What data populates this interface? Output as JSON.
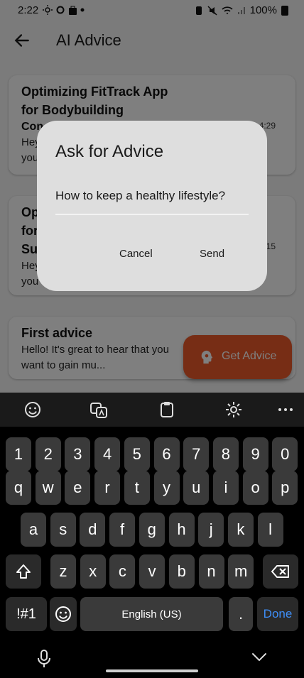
{
  "status": {
    "time": "2:22",
    "battery": "100%"
  },
  "appbar": {
    "title": "AI Advice"
  },
  "cards": [
    {
      "title_line1": "Optimizing FitTrack App",
      "title_line2": "for Bodybuilding",
      "title_line3": "Con",
      "time": "4:29",
      "body_line1": "Hey",
      "body_line2": "you"
    },
    {
      "title_line1": "Op",
      "title_line2": "for",
      "title_line3": "Su",
      "time": "15",
      "body_line1": "Hey",
      "body_line2": "you"
    },
    {
      "title_line1": "First advice",
      "body_line1": "Hello! It's great to hear that you",
      "body_line2": "want to gain mu..."
    }
  ],
  "fab": {
    "label": "Get Advice",
    "icon": "head-gear-icon"
  },
  "dialog": {
    "title": "Ask for Advice",
    "input_value": "How to keep a healthy lifestyle?",
    "cancel_label": "Cancel",
    "send_label": "Send"
  },
  "keyboard": {
    "toolbar_icons": [
      "emoji-icon",
      "translate-icon",
      "clipboard-icon",
      "settings-icon",
      "more-icon"
    ],
    "row_numbers": [
      "1",
      "2",
      "3",
      "4",
      "5",
      "6",
      "7",
      "8",
      "9",
      "0"
    ],
    "row1": [
      "q",
      "w",
      "e",
      "r",
      "t",
      "y",
      "u",
      "i",
      "o",
      "p"
    ],
    "row2": [
      "a",
      "s",
      "d",
      "f",
      "g",
      "h",
      "j",
      "k",
      "l"
    ],
    "row3": [
      "z",
      "x",
      "c",
      "v",
      "b",
      "n",
      "m"
    ],
    "symbols_label": "!#1",
    "space_label": "English (US)",
    "period_label": ".",
    "done_label": "Done"
  },
  "colors": {
    "accent": "#ef5a2b",
    "done": "#3e8ef7"
  }
}
